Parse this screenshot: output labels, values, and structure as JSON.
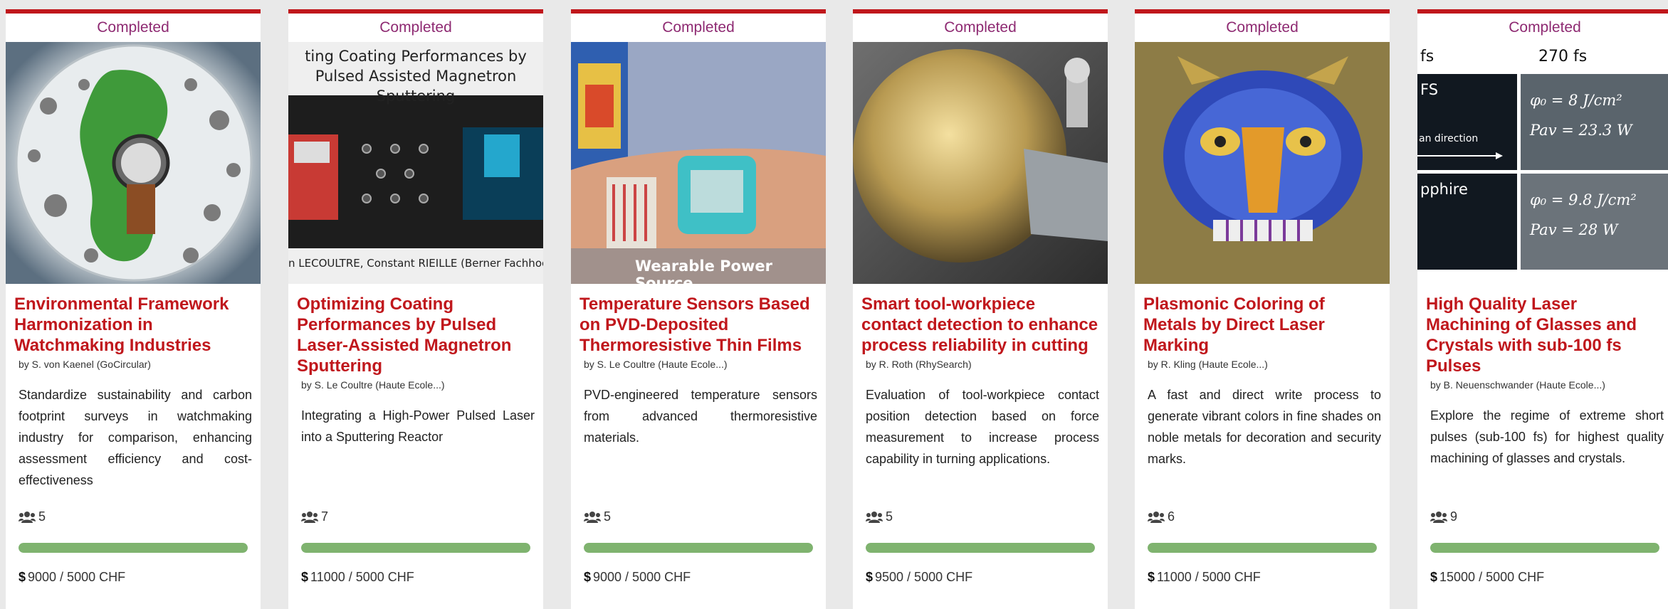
{
  "cards": [
    {
      "status": "Completed",
      "title": "Environmental Framework Harmonization in Watchmaking Industries",
      "author": "by S. von Kaenel (GoCircular)",
      "description": "Standardize sustainability and carbon footprint surveys in watchmaking industry for comparison, enhancing assessment efficiency and cost-effectiveness",
      "members": "5",
      "funding": "9000 / 5000 CHF",
      "progress": 1.0
    },
    {
      "status": "Completed",
      "title": "Optimizing Coating Performances by Pulsed Laser-Assisted Magnetron Sputtering",
      "author": "by S. Le Coultre (Haute Ecole...)",
      "description": "Integrating a High-Power Pulsed Laser into a Sputtering Reactor",
      "members": "7",
      "funding": "11000 / 5000 CHF",
      "progress": 1.0,
      "image_text": {
        "top": "ting Coating Performances by Pulsed Assisted Magnetron Sputtering",
        "bottom": "n LECOULTRE, Constant RIEILLE (Berner Fachhochs"
      }
    },
    {
      "status": "Completed",
      "title": "Temperature Sensors Based on PVD-Deposited Thermoresistive Thin Films",
      "author": "by S. Le Coultre (Haute Ecole...)",
      "description": "PVD-engineered temperature sensors from advanced thermoresistive materials.",
      "members": "5",
      "funding": "9000 / 5000 CHF",
      "progress": 1.0,
      "image_text": {
        "caption": "Wearable Power Source"
      }
    },
    {
      "status": "Completed",
      "title": "Smart tool-workpiece contact detection to enhance process reliability in cutting",
      "author": "by R. Roth (RhySearch)",
      "description": "Evaluation of tool-workpiece contact position detection based on force measurement to increase process capability in turning applications.",
      "members": "5",
      "funding": "9500 / 5000 CHF",
      "progress": 1.0
    },
    {
      "status": "Completed",
      "title": "Plasmonic Coloring of Metals by Direct Laser Marking",
      "author": "by R. Kling (Haute Ecole...)",
      "description": "A fast and direct write process to generate vibrant colors in fine shades on noble metals for decoration and security marks.",
      "members": "6",
      "funding": "11000 / 5000 CHF",
      "progress": 1.0
    },
    {
      "status": "Completed",
      "title": "High Quality Laser Machining of Glasses and Crystals with sub-100 fs Pulses",
      "author": "by B. Neuenschwander (Haute Ecole...)",
      "description": "Explore the regime of extreme short pulses (sub-100 fs) for highest quality machining of glasses and crystals.",
      "members": "9",
      "funding": "15000 / 5000 CHF",
      "progress": 1.0,
      "image_text": {
        "h_left": "fs",
        "h_right": "270 fs",
        "row1_label": "FS",
        "row1_sub": "an direction",
        "row2_label": "pphire",
        "eq1a": "φ₀ = 8 J/cm²",
        "eq1b": "Pav = 23.3 W",
        "eq2a": "φ₀ = 9.8 J/cm²",
        "eq2b": "Pav = 28 W"
      }
    }
  ],
  "currency_icon": "$",
  "icons": {
    "members": "users-icon"
  },
  "colors": {
    "accent": "#c0171c",
    "status": "#8e2a72",
    "progress": "#7fb36f"
  }
}
